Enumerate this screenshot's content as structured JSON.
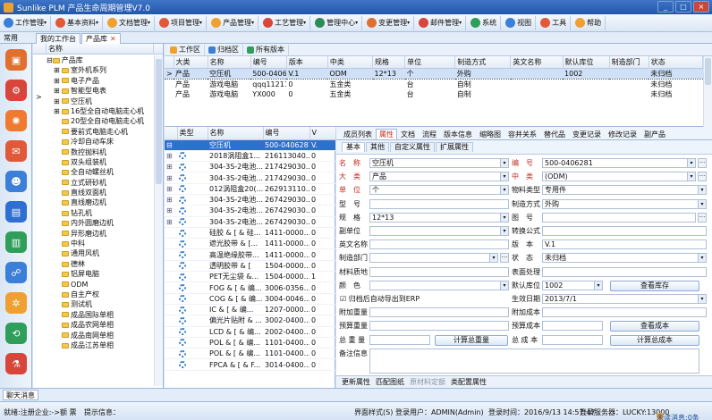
{
  "app": {
    "title": "Sunlike PLM 产品生命周期管理V7.0"
  },
  "menu": [
    {
      "label": "工作管理",
      "color": "#3b7fd8"
    },
    {
      "label": "基本资料",
      "color": "#e05a3a"
    },
    {
      "label": "文档管理",
      "color": "#f0a030"
    },
    {
      "label": "项目管理",
      "color": "#e05a3a"
    },
    {
      "label": "产品管理",
      "color": "#f0a030"
    },
    {
      "label": "工艺管理",
      "color": "#d8453a"
    },
    {
      "label": "管理中心",
      "color": "#2e8b57"
    },
    {
      "label": "变更管理",
      "color": "#e07030"
    },
    {
      "label": "邮件管理",
      "color": "#d8453a"
    },
    {
      "label": "系统",
      "color": "#2e9e5a"
    },
    {
      "label": "视图",
      "color": "#3b7fd8"
    },
    {
      "label": "工具",
      "color": "#e05a3a"
    },
    {
      "label": "帮助",
      "color": "#f0a030"
    }
  ],
  "left_tab": "常用",
  "nav_tabs": [
    "我的工作台",
    "产品库"
  ],
  "left_icons": [
    "box-icon",
    "gear-icon",
    "settings-icon",
    "mail-icon",
    "user-icon",
    "report-icon",
    "chart-icon",
    "people-icon",
    "cogs-icon",
    "flow-icon",
    "bottle-icon"
  ],
  "tree": {
    "header": "名称",
    "root": "产品库",
    "items": [
      "室外机系列",
      "电子产品",
      "智能型电表",
      "空压机",
      "16型全自动电脑走心机",
      "20型全自动电脑走心机",
      "要前式电脑走心机",
      "冷却自动车床",
      "数控抛料机",
      "双头组装机",
      "全自动螺丝机",
      "立式研砂机",
      "直线双面机",
      "直线磨边机",
      "钻孔机",
      "内外圆磨边机",
      "异形磨边机",
      "中科",
      "通用风机",
      "德林",
      "铝屏电脑",
      "ODM",
      "自主产权",
      "测试机",
      "成品国际单相",
      "成品农网单相",
      "成品南网单相",
      "成品江苏单相"
    ]
  },
  "toolbar": {
    "work_area": "工作区",
    "archive": "归档区",
    "all_versions": "所有版本"
  },
  "top_grid": {
    "columns": [
      "大类",
      "名称",
      "编号",
      "版本",
      "中类",
      "规格",
      "单位",
      "制造方式",
      "英文名称",
      "默认库位",
      "制造部门",
      "状态"
    ],
    "rows": [
      [
        "产品",
        "空压机",
        "500-0406281",
        "V.1",
        "ODM",
        "12*13",
        "个",
        "外购",
        "",
        "1002",
        "",
        "未归档"
      ],
      [
        "产品",
        "游戏电脑",
        "qqq11211",
        "0",
        "五金类",
        "",
        "台",
        "自制",
        "",
        "",
        "",
        "未归档"
      ],
      [
        "产品",
        "游戏电脑",
        "YX000",
        "0",
        "五金类",
        "",
        "台",
        "自制",
        "",
        "",
        "",
        "未归档"
      ]
    ]
  },
  "bom": {
    "columns": [
      "类型",
      "名称",
      "编号",
      "V"
    ],
    "rows": [
      [
        "",
        "空压机",
        "500-0406281",
        "V."
      ],
      [
        "",
        "2018涡阻盒1...",
        "216113040...",
        "0"
      ],
      [
        "",
        "304-3S-2电池...",
        "217429030...",
        "0"
      ],
      [
        "",
        "304-3S-2电池...",
        "217429030...",
        "0"
      ],
      [
        "",
        "012涡阻盒20(...",
        "262913110...",
        "0"
      ],
      [
        "",
        "304-3S-2电池...",
        "267429030...",
        "0"
      ],
      [
        "",
        "304-3S-2电池...",
        "267429030...",
        "0"
      ],
      [
        "",
        "304-3S-2电池...",
        "267429030...",
        "0"
      ],
      [
        "",
        "硅胶 & [ & 硅...",
        "1411-0000...",
        "0"
      ],
      [
        "",
        "遮光胶带 & [...",
        "1411-0000...",
        "0"
      ],
      [
        "",
        "高温绝缘胶带...",
        "1411-0000...",
        "0"
      ],
      [
        "",
        "透明胶带 & [",
        "1504-0000...",
        "0"
      ],
      [
        "",
        "PET无尘袋 &...",
        "1504-0000...",
        "1"
      ],
      [
        "",
        "FOG & [ & 编...",
        "3006-0356...",
        "0"
      ],
      [
        "",
        "COG & [ & 编...",
        "3004-0046...",
        "0"
      ],
      [
        "",
        "IC & [ & 编...",
        "1207-0000...",
        "0"
      ],
      [
        "",
        "偏光片贴附 & ...",
        "3002-0400...",
        "0"
      ],
      [
        "",
        "LCD & [ & 编...",
        "2002-0400...",
        "0"
      ],
      [
        "",
        "POL & [ & 编...",
        "1101-0400...",
        "0"
      ],
      [
        "",
        "POL & [ & 编...",
        "1101-0400...",
        "0"
      ],
      [
        "",
        "FPCA & [ & F...",
        "3014-0400...",
        "0"
      ]
    ]
  },
  "detail_tabs": [
    "成员列表",
    "属性",
    "文档",
    "流程",
    "版本信息",
    "缩略图",
    "容并关系",
    "替代品",
    "变更记录",
    "修改记录",
    "副产品"
  ],
  "form_tabs": [
    "基本",
    "其他",
    "自定义属性",
    "扩展属性"
  ],
  "form": {
    "name_label": "名　称",
    "name": "空压机",
    "code_label": "编　号",
    "code": "500-0406281",
    "major_label": "大　类",
    "major": "产品",
    "mid_label": "中　类",
    "mid": "(ODM)",
    "unit_label": "单　位",
    "unit": "个",
    "matclass_label": "物料类型",
    "matclass": "专用件",
    "model_label": "型　号",
    "model": "",
    "mfg_label": "制造方式",
    "mfg": "外购",
    "spec_label": "规　格",
    "spec": "12*13",
    "drawing_label": "图　号",
    "drawing": "",
    "subunit_label": "副单位",
    "subunit": "",
    "convert_label": "转换公式",
    "convert": "",
    "eng_label": "英文名称",
    "eng": "",
    "version_label": "版　本",
    "version": "V.1",
    "dept_label": "制造部门",
    "dept": "",
    "status_label": "状　态",
    "status": "未归档",
    "material_label": "材料质地",
    "material": "",
    "surface_label": "表面处理",
    "surface": "",
    "color_label": "颜　色",
    "color": "",
    "loc_label": "默认库位",
    "loc": "1002",
    "view_stock_btn": "查看库存",
    "erp_check": "归档后自动导出到ERP",
    "date_label": "生效日期",
    "date": "2013/7/1",
    "addweight_label": "附加重量",
    "addweight": "",
    "addcost_label": "附加成本",
    "addcost": "",
    "estweight_label": "预算重量",
    "estweight": "",
    "estcost_label": "预算成本",
    "estcost": "",
    "view_cost_btn": "查看成本",
    "totalweight_label": "总 重 量",
    "totalweight": "",
    "calc_weight_btn": "计算总重量",
    "totalcost_label": "总 成 本",
    "totalcost": "",
    "calc_cost_btn": "计算总成本",
    "note_label": "备注信息",
    "note": ""
  },
  "detail_bottom": [
    "更新属性",
    "匹配图纸",
    "原材料定额",
    "类配置属性"
  ],
  "bottom_tab": "聊天消息",
  "status": {
    "left": "就绪:注册企业:->额 票",
    "hint": "提示信息：",
    "style": "界面样式(S)",
    "user": "登录用户：ADMIN(Admin)",
    "time": "登录时间：2016/9/13 14:57:47",
    "server": "登录服务器：LUCKY:13000",
    "unread": "未读消息:0条"
  }
}
